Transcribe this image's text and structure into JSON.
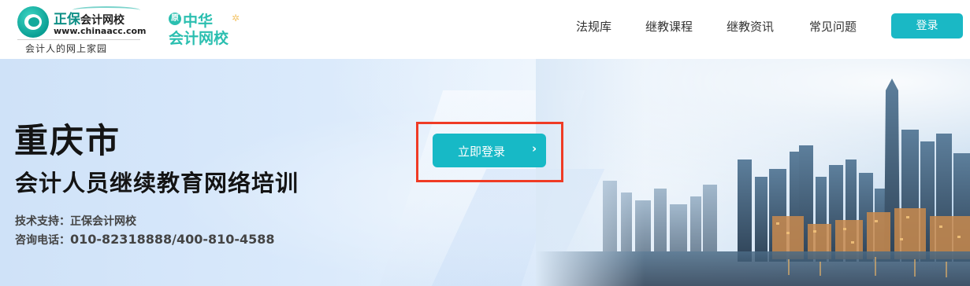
{
  "header": {
    "logo_zhengbao": {
      "name_main": "正保",
      "name_small": "会计网校",
      "url": "www.chinaacc.com",
      "slogan": "会计人的网上家园"
    },
    "logo_zhonghua": {
      "badge": "原",
      "line1": "中华",
      "line2": "会计网校"
    },
    "nav": [
      {
        "label": "法规库"
      },
      {
        "label": "继教课程"
      },
      {
        "label": "继教资讯"
      },
      {
        "label": "常见问题"
      }
    ],
    "login_label": "登录"
  },
  "banner": {
    "city_title": "重庆市",
    "subtitle": "会计人员继续教育网络培训",
    "support_label": "技术支持：",
    "support_value": "正保会计网校",
    "phone_label": "咨询电话：",
    "phone_value": "010-82318888/400-810-4588",
    "cta_label": "立即登录",
    "cta_arrow": "›"
  },
  "colors": {
    "accent": "#1ab8c5",
    "highlight_frame": "#ef3b25",
    "brand_green": "#0e8f86"
  }
}
